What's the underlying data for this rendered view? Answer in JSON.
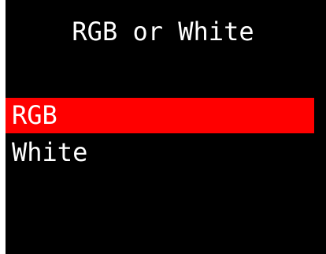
{
  "screen": {
    "title": "RGB or White",
    "background_color": "#000000",
    "text_color": "#ffffff",
    "highlight_color": "#ff0000"
  },
  "menu": {
    "items": [
      {
        "label": "RGB",
        "selected": true
      },
      {
        "label": "White",
        "selected": false
      }
    ]
  }
}
